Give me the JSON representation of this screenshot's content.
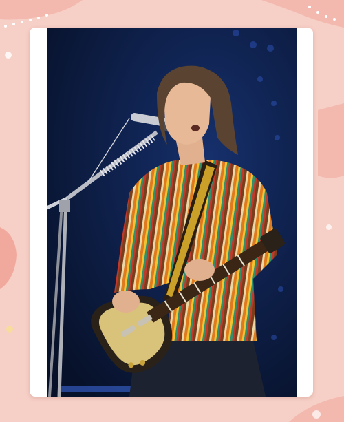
{
  "image": {
    "subject": "guitarist-performing-with-microphone",
    "colors": {
      "page_background": "#f6cfc6",
      "frame": "#ffffff",
      "stage_background": "#0c1a3e",
      "shirt_stripes": [
        "#e07a1f",
        "#f2c230",
        "#2f8f6f",
        "#c0392b",
        "#7a3e1d",
        "#e9d8a6"
      ],
      "guitar_top": "#d9c27a",
      "guitar_body_dark": "#2a2118"
    }
  }
}
